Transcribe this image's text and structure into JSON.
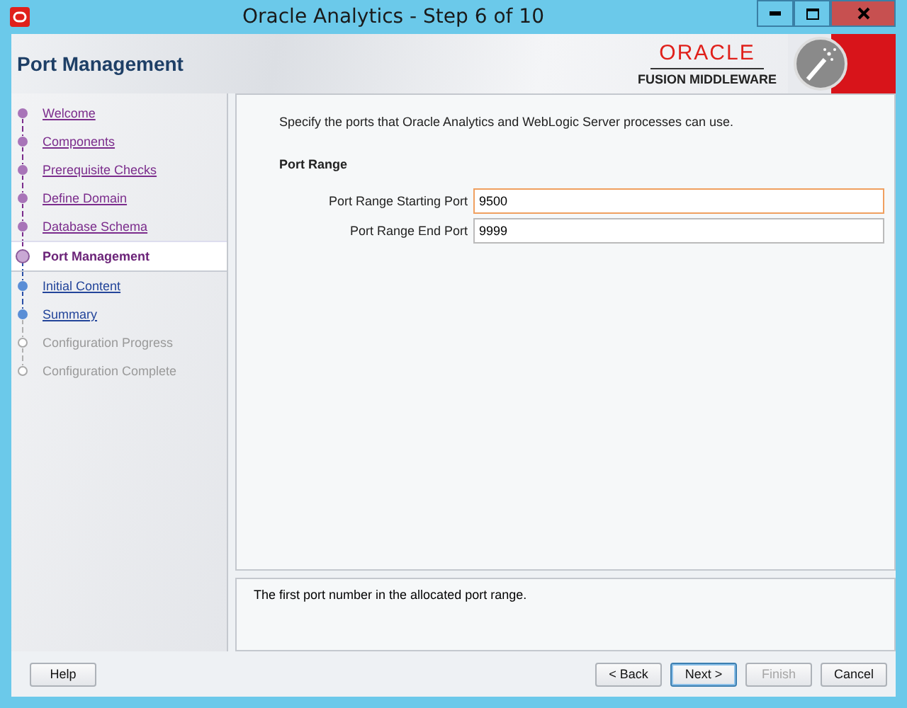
{
  "window": {
    "title": "Oracle Analytics - Step 6 of 10"
  },
  "header": {
    "title": "Port Management",
    "brand": "ORACLE",
    "subtitle": "FUSION MIDDLEWARE"
  },
  "steps": [
    {
      "label": "Welcome",
      "kind": "done",
      "selected": false
    },
    {
      "label": "Components",
      "kind": "done",
      "selected": false
    },
    {
      "label": "Prerequisite Checks",
      "kind": "done",
      "selected": false
    },
    {
      "label": "Define Domain",
      "kind": "done",
      "selected": false
    },
    {
      "label": "Database Schema",
      "kind": "done",
      "selected": false
    },
    {
      "label": "Port Management",
      "kind": "current",
      "selected": true
    },
    {
      "label": "Initial Content",
      "kind": "next",
      "selected": false
    },
    {
      "label": "Summary",
      "kind": "next",
      "selected": false
    },
    {
      "label": "Configuration Progress",
      "kind": "disabled",
      "selected": false
    },
    {
      "label": "Configuration Complete",
      "kind": "disabled",
      "selected": false
    }
  ],
  "intro": "Specify the ports that Oracle Analytics and WebLogic Server processes can use.",
  "section": "Port Range",
  "fields": [
    {
      "label": "Port Range Starting Port",
      "value": "9500",
      "focused": true
    },
    {
      "label": "Port Range End Port",
      "value": "9999",
      "focused": false
    }
  ],
  "help_text": "The first port number in the allocated port range.",
  "buttons": [
    {
      "label": "Help",
      "kind": "left",
      "disabled": false,
      "default": false
    },
    {
      "label": "< Back",
      "kind": "right",
      "disabled": false,
      "default": false
    },
    {
      "label": "Next >",
      "kind": "right",
      "disabled": false,
      "default": true
    },
    {
      "label": "Finish",
      "kind": "right",
      "disabled": true,
      "default": false
    },
    {
      "label": "Cancel",
      "kind": "right",
      "disabled": false,
      "default": false
    }
  ]
}
